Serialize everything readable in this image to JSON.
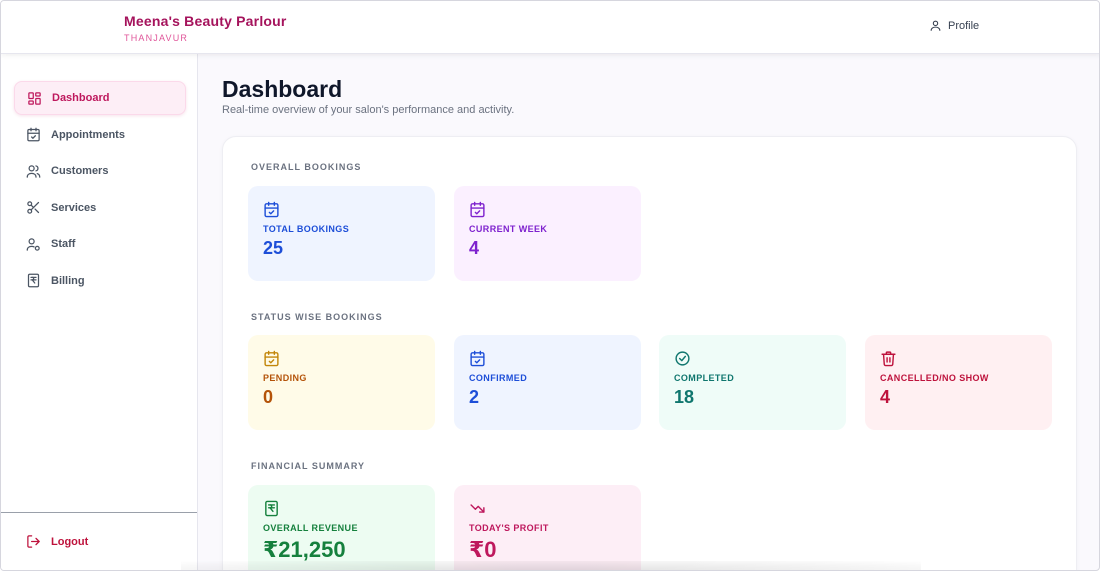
{
  "header": {
    "brand_name": "Meena's Beauty Parlour",
    "brand_city": "THANJAVUR",
    "profile_label": "Profile"
  },
  "sidebar": {
    "items": [
      {
        "label": "Dashboard",
        "icon": "dashboard-icon",
        "active": true
      },
      {
        "label": "Appointments",
        "icon": "calendar-icon",
        "active": false
      },
      {
        "label": "Customers",
        "icon": "users-icon",
        "active": false
      },
      {
        "label": "Services",
        "icon": "scissors-icon",
        "active": false
      },
      {
        "label": "Staff",
        "icon": "staff-icon",
        "active": false
      },
      {
        "label": "Billing",
        "icon": "receipt-icon",
        "active": false
      }
    ],
    "logout_label": "Logout"
  },
  "main": {
    "title": "Dashboard",
    "subtitle": "Real-time overview of your salon's performance and activity.",
    "sections": {
      "overall": {
        "label": "OVERALL BOOKINGS",
        "cards": [
          {
            "label": "TOTAL BOOKINGS",
            "value": "25",
            "icon": "calendar-check-icon",
            "accent": "#1d4ed8",
            "bg": "#eff4ff"
          },
          {
            "label": "CURRENT WEEK",
            "value": "4",
            "icon": "calendar-check-icon",
            "accent": "#7e22ce",
            "bg": "#fbf0ff"
          }
        ]
      },
      "status": {
        "label": "STATUS WISE BOOKINGS",
        "cards": [
          {
            "label": "PENDING",
            "value": "0",
            "icon": "calendar-check-icon",
            "accent": "#b45309",
            "bg": "#fffbe8"
          },
          {
            "label": "CONFIRMED",
            "value": "2",
            "icon": "calendar-check-icon",
            "accent": "#1d4ed8",
            "bg": "#eff4ff"
          },
          {
            "label": "COMPLETED",
            "value": "18",
            "icon": "check-circle-icon",
            "accent": "#0f766e",
            "bg": "#effcf8"
          },
          {
            "label": "CANCELLED/NO SHOW",
            "value": "4",
            "icon": "trash-icon",
            "accent": "#be123c",
            "bg": "#fff0f2"
          }
        ]
      },
      "financial": {
        "label": "FINANCIAL SUMMARY",
        "cards": [
          {
            "label": "OVERALL REVENUE",
            "value": "₹21,250",
            "icon": "rupee-receipt-icon",
            "accent": "#15803d",
            "bg": "#edfcf2"
          },
          {
            "label": "TODAY'S PROFIT",
            "value": "₹0",
            "icon": "trending-down-icon",
            "accent": "#be185d",
            "bg": "#fdeef6"
          }
        ]
      }
    }
  }
}
